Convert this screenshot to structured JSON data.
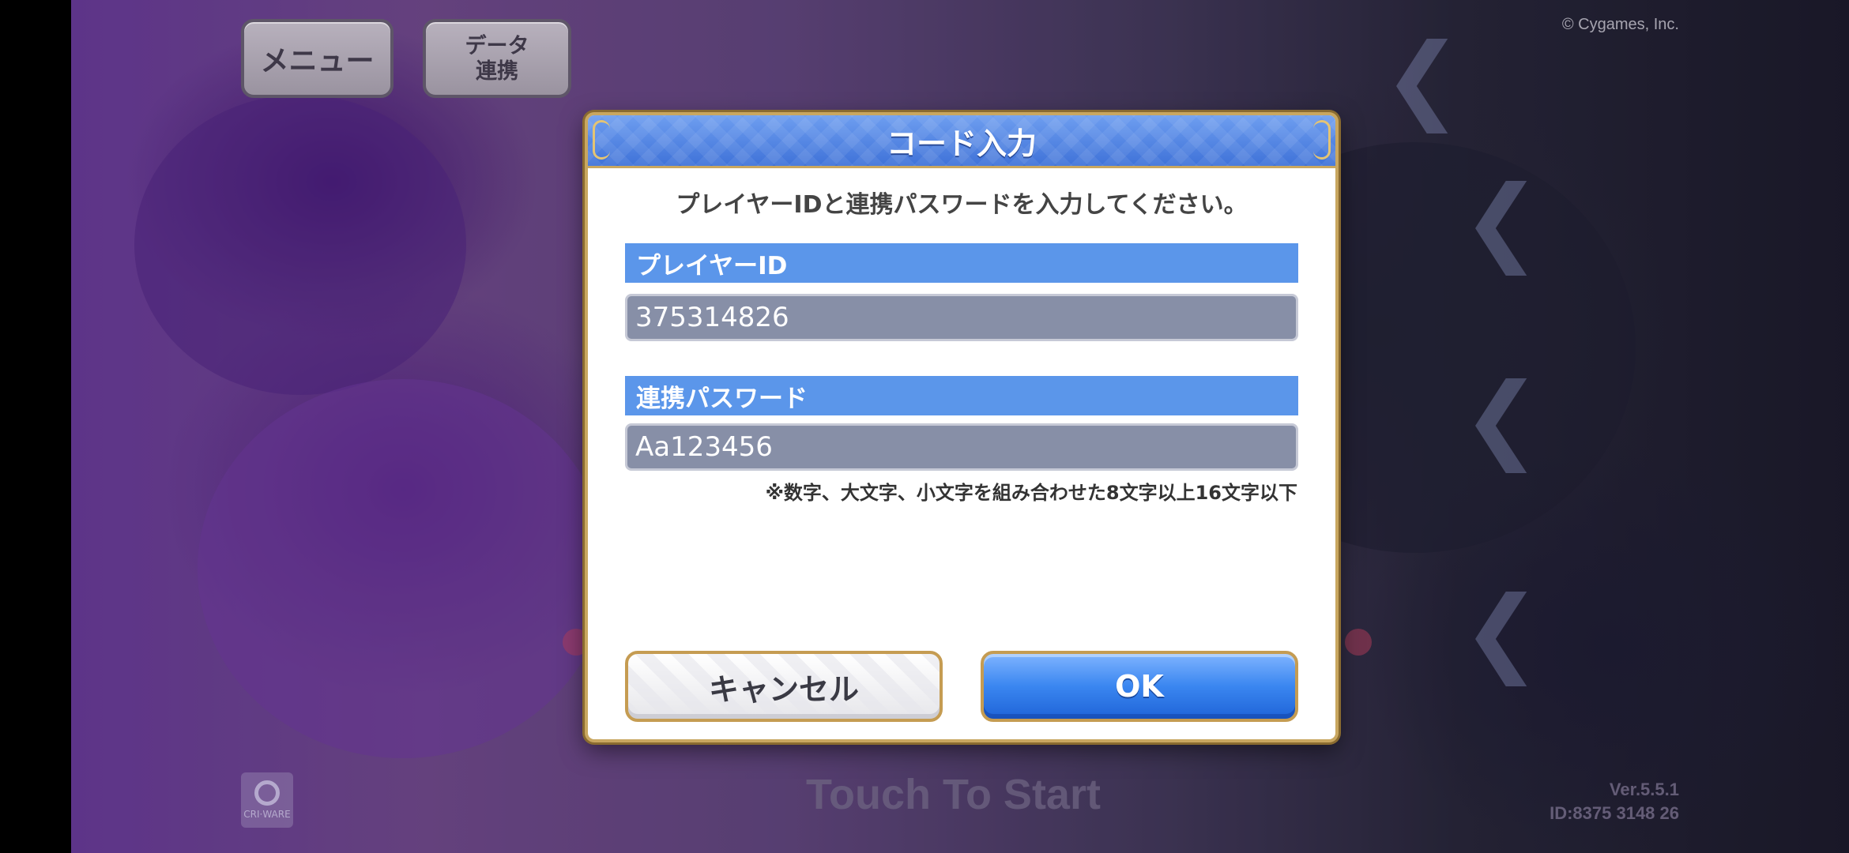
{
  "background": {
    "menu_label": "メニュー",
    "data_link_label": "データ\n連携",
    "copyright": "© Cygames, Inc.",
    "touch_to_start": "Touch To Start",
    "version": "Ver.5.5.1",
    "device_id": "ID:8375 3148 26",
    "cri_logo_text": "CRI·WARE"
  },
  "dialog": {
    "title": "コード入力",
    "instruction": "プレイヤーIDと連携パスワードを入力してください。",
    "player_id_label": "プレイヤーID",
    "player_id_value": "375314826",
    "password_label": "連携パスワード",
    "password_value": "Aa123456",
    "password_note": "※数字、大文字、小文字を組み合わせた8文字以上16文字以下",
    "cancel_label": "キャンセル",
    "ok_label": "OK"
  },
  "colors": {
    "header_blue": "#3f72d8",
    "label_blue": "#5b96ea",
    "input_gray": "#878fa7",
    "gold_border": "#c9a760",
    "ok_blue": "#3a86f0"
  }
}
